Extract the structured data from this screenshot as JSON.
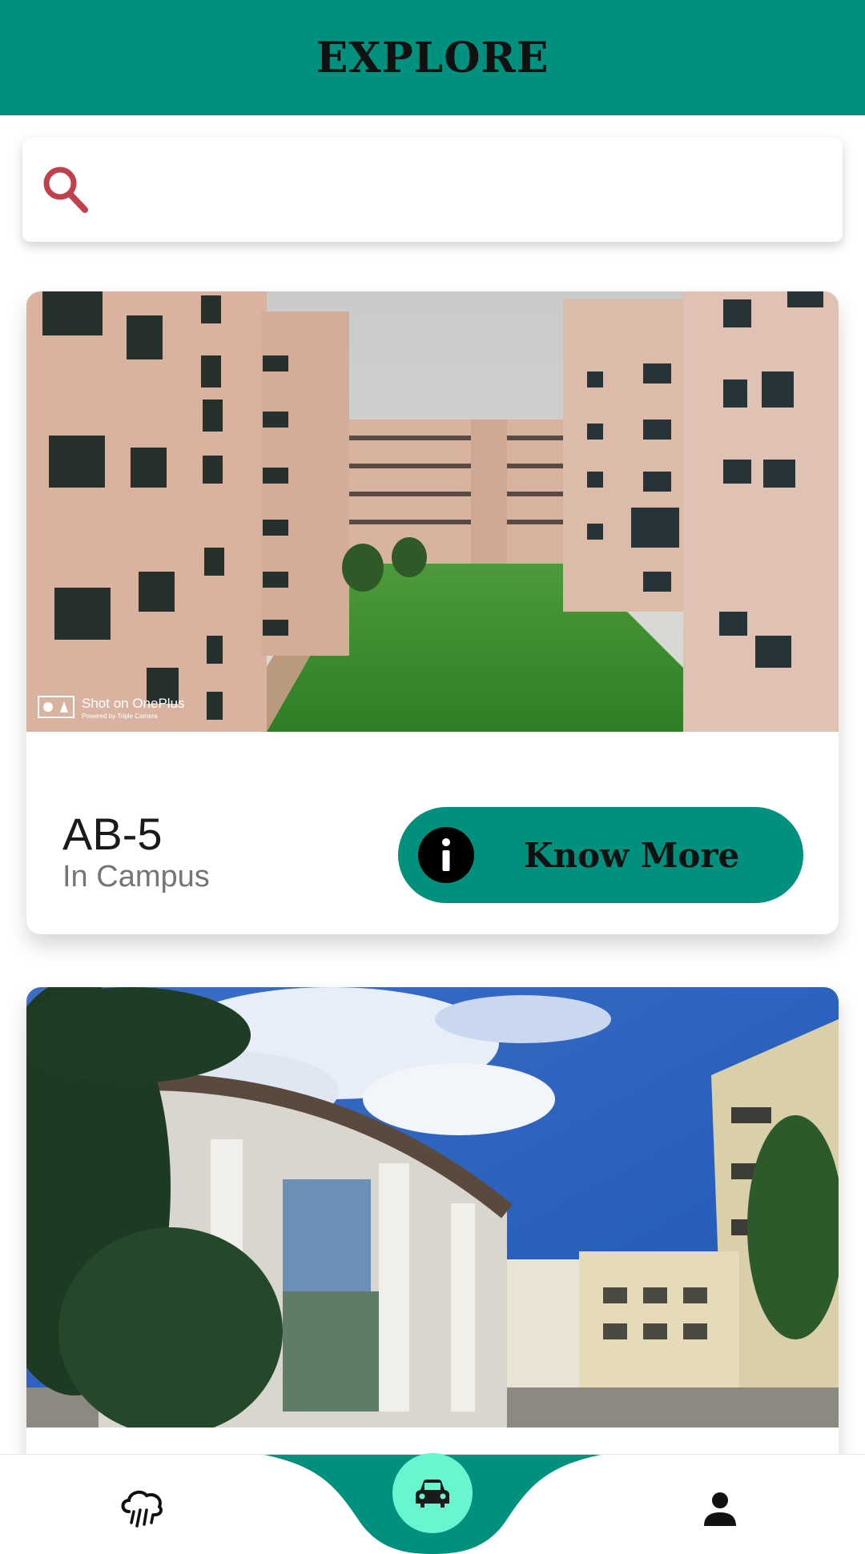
{
  "header": {
    "title": "EXPLORE"
  },
  "search": {
    "placeholder": "",
    "value": ""
  },
  "cards": [
    {
      "title": "AB-5",
      "subtitle": "In Campus",
      "button_label": "Know More",
      "photo_watermark": "Shot on OnePlus",
      "photo_watermark_sub": "Powered by Triple Camera"
    },
    {
      "title": "",
      "subtitle": "",
      "button_label": ""
    }
  ],
  "bottom_nav": {
    "items": [
      {
        "icon": "weather-icon"
      },
      {
        "icon": "car-icon",
        "active": true
      },
      {
        "icon": "person-icon"
      }
    ]
  },
  "colors": {
    "primary": "#00907e",
    "accent_fab": "#69f5cf",
    "search_icon": "#c0404d"
  }
}
